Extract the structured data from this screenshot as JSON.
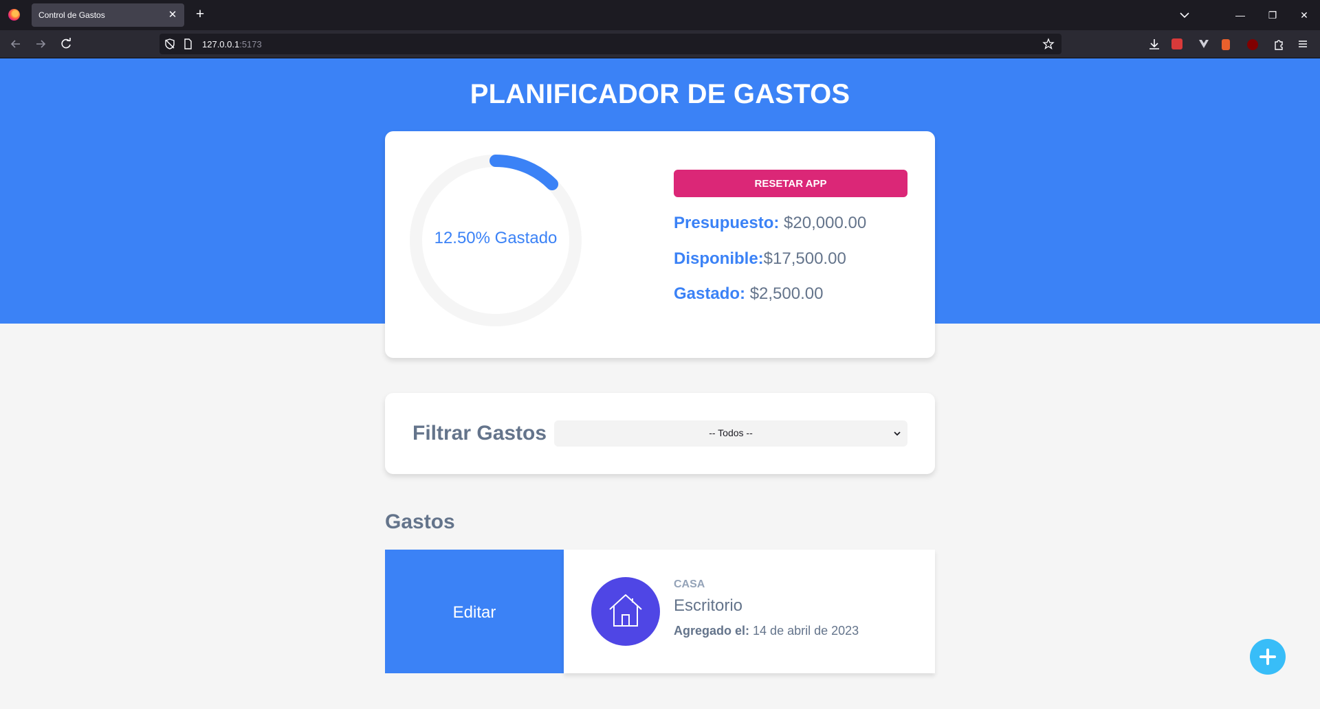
{
  "browser": {
    "tab_title": "Control de Gastos",
    "url_host": "127.0.0.1",
    "url_port": ":5173"
  },
  "header": {
    "title": "PLANIFICADOR DE GASTOS"
  },
  "budget": {
    "progress_label": "12.50% Gastado",
    "progress_percent": 12.5,
    "reset_label": "RESETAR APP",
    "presupuesto_label": "Presupuesto:",
    "presupuesto_value": "$20,000.00",
    "disponible_label": "Disponible:",
    "disponible_value": "$17,500.00",
    "gastado_label": "Gastado:",
    "gastado_value": "$2,500.00"
  },
  "filter": {
    "label": "Filtrar Gastos",
    "selected": "-- Todos --"
  },
  "expenses": {
    "title": "Gastos",
    "items": [
      {
        "edit_label": "Editar",
        "category": "CASA",
        "name": "Escritorio",
        "date_label": "Agregado el:",
        "date_value": "14 de abril de 2023",
        "icon": "house-icon"
      }
    ]
  },
  "colors": {
    "primary": "#3b82f6",
    "reset": "#db2777",
    "icon_bg": "#4f46e5",
    "fab": "#38bdf8",
    "ring_track": "#f5f5f5"
  },
  "icons": [
    "firefox-icon",
    "close-icon",
    "plus-icon",
    "chevron-down-icon",
    "minimize-icon",
    "restore-icon",
    "back-icon",
    "forward-icon",
    "reload-icon",
    "shield-icon",
    "page-icon",
    "star-icon",
    "download-icon",
    "extension-icon",
    "menu-icon",
    "house-icon",
    "add-icon"
  ]
}
